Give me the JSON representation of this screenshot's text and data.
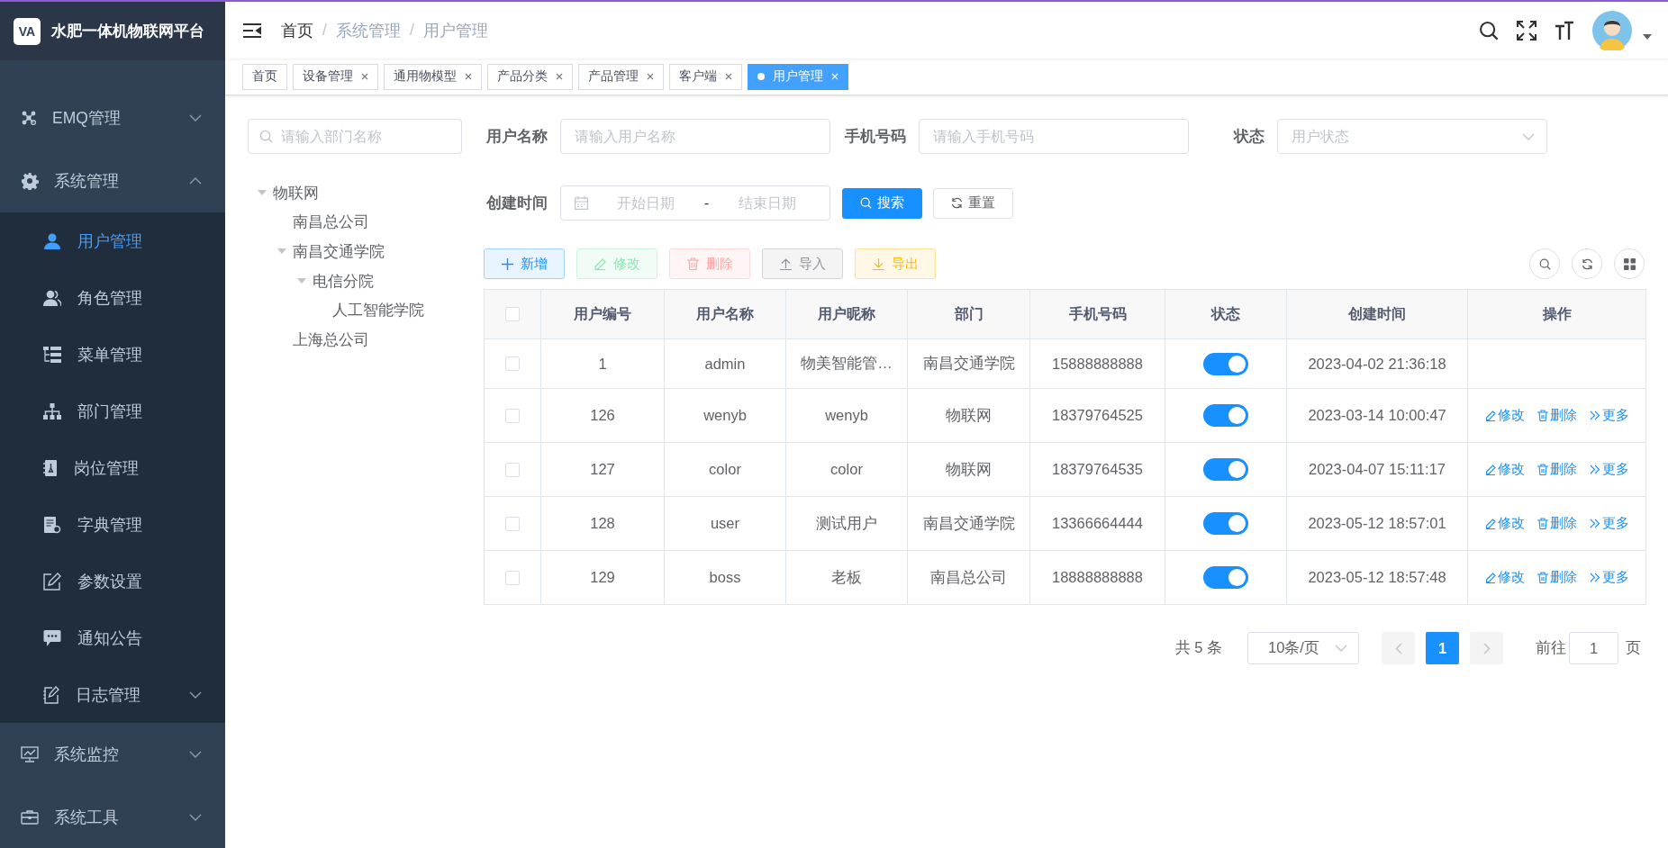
{
  "brand": {
    "logo": "VA",
    "title": "水肥一体机物联网平台"
  },
  "sidebar": {
    "items": [
      {
        "label": "EMQ管理",
        "expanded": false
      },
      {
        "label": "系统管理",
        "expanded": true,
        "children": [
          {
            "label": "用户管理",
            "kind": "item",
            "selected": true
          },
          {
            "label": "角色管理",
            "kind": "item",
            "selected": false
          },
          {
            "label": "菜单管理",
            "kind": "item",
            "selected": false
          },
          {
            "label": "部门管理",
            "kind": "item",
            "selected": false
          },
          {
            "label": "岗位管理",
            "kind": "item",
            "selected": false
          },
          {
            "label": "字典管理",
            "kind": "item",
            "selected": false
          },
          {
            "label": "参数设置",
            "kind": "item",
            "selected": false
          },
          {
            "label": "通知公告",
            "kind": "item",
            "selected": false
          },
          {
            "label": "日志管理",
            "kind": "submenu",
            "selected": false,
            "expanded": false
          }
        ]
      },
      {
        "label": "系统监控",
        "expanded": false
      },
      {
        "label": "系统工具",
        "expanded": false
      }
    ]
  },
  "breadcrumb": {
    "items": [
      {
        "label": "首页",
        "link": true
      },
      {
        "label": "系统管理",
        "link": false
      },
      {
        "label": "用户管理",
        "link": false
      }
    ],
    "separators": [
      "/",
      "/"
    ]
  },
  "tags": [
    {
      "label": "首页",
      "closable": false,
      "selected": false
    },
    {
      "label": "设备管理",
      "closable": true,
      "selected": false
    },
    {
      "label": "通用物模型",
      "closable": true,
      "selected": false
    },
    {
      "label": "产品分类",
      "closable": true,
      "selected": false
    },
    {
      "label": "产品管理",
      "closable": true,
      "selected": false
    },
    {
      "label": "客户端",
      "closable": true,
      "selected": false
    },
    {
      "label": "用户管理",
      "closable": true,
      "selected": true
    }
  ],
  "dept_tree": {
    "placeholder": "请输入部门名称",
    "nodes": [
      {
        "label": "物联网",
        "expanded": true,
        "children": [
          {
            "label": "南昌总公司"
          },
          {
            "label": "南昌交通学院",
            "expanded": true,
            "children": [
              {
                "label": "电信分院",
                "expanded": true,
                "children": [
                  {
                    "label": "人工智能学院"
                  }
                ]
              }
            ]
          },
          {
            "label": "上海总公司"
          }
        ]
      }
    ]
  },
  "filter": {
    "fields": [
      {
        "label": "用户名称",
        "kind": "text",
        "placeholder": "请输入用户名称"
      },
      {
        "label": "手机号码",
        "kind": "text",
        "placeholder": "请输入手机号码"
      },
      {
        "label": "状态",
        "kind": "select",
        "placeholder": "用户状态"
      },
      {
        "label": "创建时间",
        "kind": "daterange",
        "start_placeholder": "开始日期",
        "separator": "-",
        "end_placeholder": "结束日期"
      }
    ],
    "buttons": [
      {
        "label": "搜索",
        "kind": "search"
      },
      {
        "label": "重置",
        "kind": "reset"
      }
    ]
  },
  "toolbar": {
    "buttons": [
      {
        "label": "新增",
        "kind": "add",
        "disabled": false
      },
      {
        "label": "修改",
        "kind": "edit",
        "disabled": true
      },
      {
        "label": "删除",
        "kind": "delete",
        "disabled": true
      },
      {
        "label": "导入",
        "kind": "import",
        "disabled": false
      },
      {
        "label": "导出",
        "kind": "export",
        "disabled": false
      }
    ]
  },
  "table": {
    "all_checked": false,
    "columns": [
      "用户编号",
      "用户名称",
      "用户昵称",
      "部门",
      "手机号码",
      "状态",
      "创建时间",
      "操作"
    ],
    "rows": [
      {
        "checked": false,
        "user_id": "1",
        "user_name": "admin",
        "nick_name": "物美智能管…",
        "dept": "南昌交通学院",
        "phone": "15888888888",
        "enabled": true,
        "created": "2023-04-02 21:36:18"
      },
      {
        "checked": false,
        "user_id": "126",
        "user_name": "wenyb",
        "nick_name": "wenyb",
        "dept": "物联网",
        "phone": "18379764525",
        "enabled": true,
        "created": "2023-03-14 10:00:47",
        "actions": [
          {
            "label": "修改",
            "kind": "edit"
          },
          {
            "label": "删除",
            "kind": "delete"
          },
          {
            "label": "更多",
            "kind": "more"
          }
        ]
      },
      {
        "checked": false,
        "user_id": "127",
        "user_name": "color",
        "nick_name": "color",
        "dept": "物联网",
        "phone": "18379764535",
        "enabled": true,
        "created": "2023-04-07 15:11:17",
        "actions": [
          {
            "label": "修改",
            "kind": "edit"
          },
          {
            "label": "删除",
            "kind": "delete"
          },
          {
            "label": "更多",
            "kind": "more"
          }
        ]
      },
      {
        "checked": false,
        "user_id": "128",
        "user_name": "user",
        "nick_name": "测试用户",
        "dept": "南昌交通学院",
        "phone": "13366664444",
        "enabled": true,
        "created": "2023-05-12 18:57:01",
        "actions": [
          {
            "label": "修改",
            "kind": "edit"
          },
          {
            "label": "删除",
            "kind": "delete"
          },
          {
            "label": "更多",
            "kind": "more"
          }
        ]
      },
      {
        "checked": false,
        "user_id": "129",
        "user_name": "boss",
        "nick_name": "老板",
        "dept": "南昌总公司",
        "phone": "18888888888",
        "enabled": true,
        "created": "2023-05-12 18:57:48",
        "actions": [
          {
            "label": "修改",
            "kind": "edit"
          },
          {
            "label": "删除",
            "kind": "delete"
          },
          {
            "label": "更多",
            "kind": "more"
          }
        ]
      }
    ]
  },
  "pagination": {
    "total": "共 5 条",
    "page_size": "10条/页",
    "prev_disabled": true,
    "pages": [
      {
        "label": "1",
        "selected": true
      }
    ],
    "next_disabled": true,
    "jump_label": "前往",
    "jump_value": "1",
    "jump_suffix": "页"
  }
}
